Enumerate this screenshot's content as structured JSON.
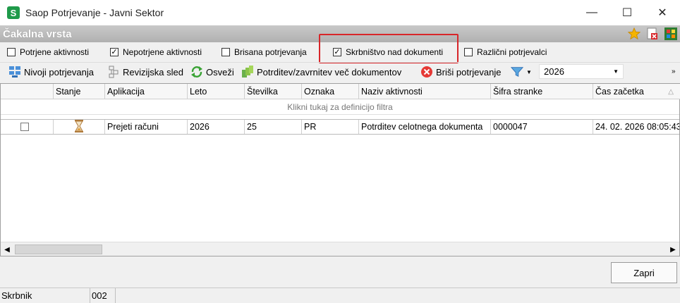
{
  "window": {
    "title": "Saop Potrjevanje - Javni Sektor",
    "app_icon_letter": "S"
  },
  "queue": {
    "title": "Čakalna vrsta"
  },
  "filters": [
    {
      "label": "Potrjene aktivnosti",
      "checked": false
    },
    {
      "label": "Nepotrjene aktivnosti",
      "checked": true
    },
    {
      "label": "Brisana potrjevanja",
      "checked": false
    },
    {
      "label": "Skrbništvo nad dokumenti",
      "checked": true
    },
    {
      "label": "Različni potrjevalci",
      "checked": false
    }
  ],
  "toolbar": {
    "levels": "Nivoji potrjevanja",
    "audit": "Revizijska sled",
    "refresh": "Osveži",
    "confirm_multi": "Potrditev/zavrnitev več dokumentov",
    "delete": "Briši potrjevanje",
    "year": "2026"
  },
  "grid": {
    "columns": [
      "",
      "Stanje",
      "Aplikacija",
      "Leto",
      "Številka",
      "Oznaka",
      "Naziv aktivnosti",
      "Šifra stranke",
      "Čas začetka"
    ],
    "filter_hint": "Klikni tukaj za definicijo filtra",
    "rows": [
      {
        "checked": false,
        "state_icon": "hourglass-icon",
        "app": "Prejeti računi",
        "year": "2026",
        "number": "25",
        "tag": "PR",
        "activity": "Potrditev celotnega dokumenta",
        "customer": "0000047",
        "start": "24. 02. 2026 08:05:43"
      }
    ]
  },
  "buttons": {
    "close": "Zapri"
  },
  "status": {
    "role": "Skrbnik",
    "code": "002"
  },
  "colors": {
    "highlight": "#d8262a",
    "accent_green": "#1f9a4a"
  }
}
